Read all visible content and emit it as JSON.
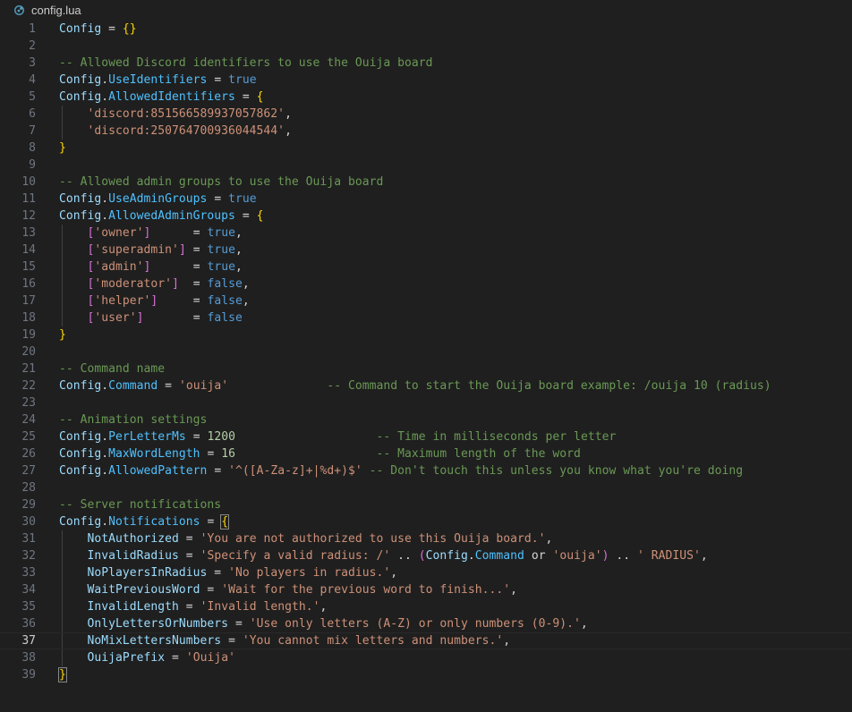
{
  "tab": {
    "filename": "config.lua",
    "icon": "lua-file-icon"
  },
  "editor": {
    "current_line": 37,
    "lines": [
      {
        "n": "1",
        "tokens": [
          [
            "v",
            "Config"
          ],
          [
            "o",
            " = "
          ],
          [
            "b1",
            "{}"
          ]
        ]
      },
      {
        "n": "2",
        "tokens": []
      },
      {
        "n": "3",
        "tokens": [
          [
            "c",
            "-- Allowed Discord identifiers to use the Ouija board"
          ]
        ]
      },
      {
        "n": "4",
        "tokens": [
          [
            "v",
            "Config"
          ],
          [
            "o",
            "."
          ],
          [
            "p",
            "UseIdentifiers"
          ],
          [
            "o",
            " = "
          ],
          [
            "k",
            "true"
          ]
        ]
      },
      {
        "n": "5",
        "tokens": [
          [
            "v",
            "Config"
          ],
          [
            "o",
            "."
          ],
          [
            "p",
            "AllowedIdentifiers"
          ],
          [
            "o",
            " = "
          ],
          [
            "b1",
            "{"
          ]
        ]
      },
      {
        "n": "6",
        "tokens": [
          [
            "o",
            "    "
          ],
          [
            "s",
            "'discord:851566589937057862'"
          ],
          [
            "o",
            ","
          ]
        ]
      },
      {
        "n": "7",
        "tokens": [
          [
            "o",
            "    "
          ],
          [
            "s",
            "'discord:250764700936044544'"
          ],
          [
            "o",
            ","
          ]
        ]
      },
      {
        "n": "8",
        "tokens": [
          [
            "b1",
            "}"
          ]
        ]
      },
      {
        "n": "9",
        "tokens": []
      },
      {
        "n": "10",
        "tokens": [
          [
            "c",
            "-- Allowed admin groups to use the Ouija board"
          ]
        ]
      },
      {
        "n": "11",
        "tokens": [
          [
            "v",
            "Config"
          ],
          [
            "o",
            "."
          ],
          [
            "p",
            "UseAdminGroups"
          ],
          [
            "o",
            " = "
          ],
          [
            "k",
            "true"
          ]
        ]
      },
      {
        "n": "12",
        "tokens": [
          [
            "v",
            "Config"
          ],
          [
            "o",
            "."
          ],
          [
            "p",
            "AllowedAdminGroups"
          ],
          [
            "o",
            " = "
          ],
          [
            "b1",
            "{"
          ]
        ]
      },
      {
        "n": "13",
        "tokens": [
          [
            "o",
            "    "
          ],
          [
            "b2",
            "["
          ],
          [
            "s",
            "'owner'"
          ],
          [
            "b2",
            "]"
          ],
          [
            "o",
            "      = "
          ],
          [
            "k",
            "true"
          ],
          [
            "o",
            ","
          ]
        ]
      },
      {
        "n": "14",
        "tokens": [
          [
            "o",
            "    "
          ],
          [
            "b2",
            "["
          ],
          [
            "s",
            "'superadmin'"
          ],
          [
            "b2",
            "]"
          ],
          [
            "o",
            " = "
          ],
          [
            "k",
            "true"
          ],
          [
            "o",
            ","
          ]
        ]
      },
      {
        "n": "15",
        "tokens": [
          [
            "o",
            "    "
          ],
          [
            "b2",
            "["
          ],
          [
            "s",
            "'admin'"
          ],
          [
            "b2",
            "]"
          ],
          [
            "o",
            "      = "
          ],
          [
            "k",
            "true"
          ],
          [
            "o",
            ","
          ]
        ]
      },
      {
        "n": "16",
        "tokens": [
          [
            "o",
            "    "
          ],
          [
            "b2",
            "["
          ],
          [
            "s",
            "'moderator'"
          ],
          [
            "b2",
            "]"
          ],
          [
            "o",
            "  = "
          ],
          [
            "k",
            "false"
          ],
          [
            "o",
            ","
          ]
        ]
      },
      {
        "n": "17",
        "tokens": [
          [
            "o",
            "    "
          ],
          [
            "b2",
            "["
          ],
          [
            "s",
            "'helper'"
          ],
          [
            "b2",
            "]"
          ],
          [
            "o",
            "     = "
          ],
          [
            "k",
            "false"
          ],
          [
            "o",
            ","
          ]
        ]
      },
      {
        "n": "18",
        "tokens": [
          [
            "o",
            "    "
          ],
          [
            "b2",
            "["
          ],
          [
            "s",
            "'user'"
          ],
          [
            "b2",
            "]"
          ],
          [
            "o",
            "       = "
          ],
          [
            "k",
            "false"
          ]
        ]
      },
      {
        "n": "19",
        "tokens": [
          [
            "b1",
            "}"
          ]
        ]
      },
      {
        "n": "20",
        "tokens": []
      },
      {
        "n": "21",
        "tokens": [
          [
            "c",
            "-- Command name"
          ]
        ]
      },
      {
        "n": "22",
        "tokens": [
          [
            "v",
            "Config"
          ],
          [
            "o",
            "."
          ],
          [
            "p",
            "Command"
          ],
          [
            "o",
            " = "
          ],
          [
            "s",
            "'ouija'"
          ],
          [
            "o",
            "              "
          ],
          [
            "c",
            "-- Command to start the Ouija board example: /ouija 10 (radius)"
          ]
        ]
      },
      {
        "n": "23",
        "tokens": []
      },
      {
        "n": "24",
        "tokens": [
          [
            "c",
            "-- Animation settings"
          ]
        ]
      },
      {
        "n": "25",
        "tokens": [
          [
            "v",
            "Config"
          ],
          [
            "o",
            "."
          ],
          [
            "p",
            "PerLetterMs"
          ],
          [
            "o",
            " = "
          ],
          [
            "n",
            "1200"
          ],
          [
            "o",
            "                    "
          ],
          [
            "c",
            "-- Time in milliseconds per letter"
          ]
        ]
      },
      {
        "n": "26",
        "tokens": [
          [
            "v",
            "Config"
          ],
          [
            "o",
            "."
          ],
          [
            "p",
            "MaxWordLength"
          ],
          [
            "o",
            " = "
          ],
          [
            "n",
            "16"
          ],
          [
            "o",
            "                    "
          ],
          [
            "c",
            "-- Maximum length of the word"
          ]
        ]
      },
      {
        "n": "27",
        "tokens": [
          [
            "v",
            "Config"
          ],
          [
            "o",
            "."
          ],
          [
            "p",
            "AllowedPattern"
          ],
          [
            "o",
            " = "
          ],
          [
            "s",
            "'^([A-Za-z]+|%d+)$'"
          ],
          [
            "o",
            " "
          ],
          [
            "c",
            "-- Don't touch this unless you know what you're doing"
          ]
        ]
      },
      {
        "n": "28",
        "tokens": []
      },
      {
        "n": "29",
        "tokens": [
          [
            "c",
            "-- Server notifications"
          ]
        ]
      },
      {
        "n": "30",
        "tokens": [
          [
            "v",
            "Config"
          ],
          [
            "o",
            "."
          ],
          [
            "p",
            "Notifications"
          ],
          [
            "o",
            " = "
          ],
          [
            "b1m",
            "{"
          ]
        ]
      },
      {
        "n": "31",
        "tokens": [
          [
            "o",
            "    "
          ],
          [
            "v",
            "NotAuthorized"
          ],
          [
            "o",
            " = "
          ],
          [
            "s",
            "'You are not authorized to use this Ouija board.'"
          ],
          [
            "o",
            ","
          ]
        ]
      },
      {
        "n": "32",
        "tokens": [
          [
            "o",
            "    "
          ],
          [
            "v",
            "InvalidRadius"
          ],
          [
            "o",
            " = "
          ],
          [
            "s",
            "'Specify a valid radius: /'"
          ],
          [
            "o",
            " .. "
          ],
          [
            "b2",
            "("
          ],
          [
            "v",
            "Config"
          ],
          [
            "o",
            "."
          ],
          [
            "p",
            "Command"
          ],
          [
            "o",
            " or "
          ],
          [
            "s",
            "'ouija'"
          ],
          [
            "b2",
            ")"
          ],
          [
            "o",
            " .. "
          ],
          [
            "s",
            "' RADIUS'"
          ],
          [
            "o",
            ","
          ]
        ]
      },
      {
        "n": "33",
        "tokens": [
          [
            "o",
            "    "
          ],
          [
            "v",
            "NoPlayersInRadius"
          ],
          [
            "o",
            " = "
          ],
          [
            "s",
            "'No players in radius.'"
          ],
          [
            "o",
            ","
          ]
        ]
      },
      {
        "n": "34",
        "tokens": [
          [
            "o",
            "    "
          ],
          [
            "v",
            "WaitPreviousWord"
          ],
          [
            "o",
            " = "
          ],
          [
            "s",
            "'Wait for the previous word to finish...'"
          ],
          [
            "o",
            ","
          ]
        ]
      },
      {
        "n": "35",
        "tokens": [
          [
            "o",
            "    "
          ],
          [
            "v",
            "InvalidLength"
          ],
          [
            "o",
            " = "
          ],
          [
            "s",
            "'Invalid length.'"
          ],
          [
            "o",
            ","
          ]
        ]
      },
      {
        "n": "36",
        "tokens": [
          [
            "o",
            "    "
          ],
          [
            "v",
            "OnlyLettersOrNumbers"
          ],
          [
            "o",
            " = "
          ],
          [
            "s",
            "'Use only letters (A-Z) or only numbers (0-9).'"
          ],
          [
            "o",
            ","
          ]
        ]
      },
      {
        "n": "37",
        "tokens": [
          [
            "o",
            "    "
          ],
          [
            "v",
            "NoMixLettersNumbers"
          ],
          [
            "o",
            " = "
          ],
          [
            "s",
            "'You cannot mix letters and numbers.'"
          ],
          [
            "o",
            ","
          ]
        ]
      },
      {
        "n": "38",
        "tokens": [
          [
            "o",
            "    "
          ],
          [
            "v",
            "OuijaPrefix"
          ],
          [
            "o",
            " = "
          ],
          [
            "s",
            "'Ouija'"
          ]
        ]
      },
      {
        "n": "39",
        "tokens": [
          [
            "b1m",
            "}"
          ]
        ]
      }
    ]
  }
}
